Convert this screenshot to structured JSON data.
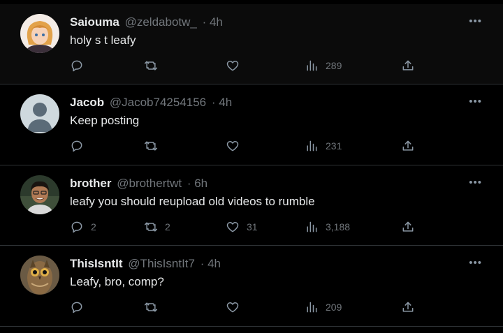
{
  "replies": [
    {
      "name": "Saiouma",
      "handle": "@zeldabotw_",
      "time": "· 4h",
      "text": "holy s   t leafy",
      "replies": "",
      "reposts": "",
      "likes": "",
      "views": "289"
    },
    {
      "name": "Jacob",
      "handle": "@Jacob74254156",
      "time": "· 4h",
      "text": "Keep posting",
      "replies": "",
      "reposts": "",
      "likes": "",
      "views": "231"
    },
    {
      "name": "brother",
      "handle": "@brothertwt",
      "time": "· 6h",
      "text": "leafy you should reupload old videos to rumble",
      "replies": "2",
      "reposts": "2",
      "likes": "31",
      "views": "3,188"
    },
    {
      "name": "ThisIsntIt",
      "handle": "@ThisIsntIt7",
      "time": "· 4h",
      "text": "Leafy, bro, comp?",
      "replies": "",
      "reposts": "",
      "likes": "",
      "views": "209"
    }
  ],
  "more_label": "•••",
  "icons": {
    "reply": "reply-icon",
    "repost": "repost-icon",
    "like": "heart-icon",
    "views": "views-icon",
    "share": "share-icon"
  },
  "colors": {
    "background": "#000000",
    "text": "#e7e9ea",
    "muted": "#71767b",
    "divider": "#2f3336"
  }
}
